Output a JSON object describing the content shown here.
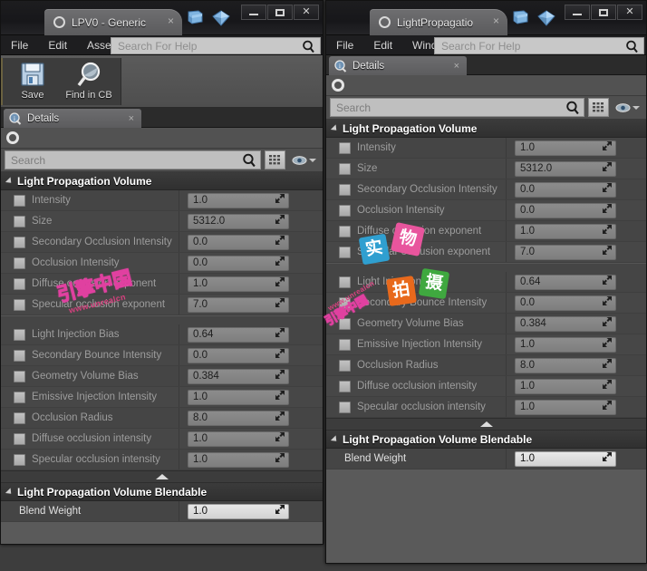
{
  "left_window": {
    "title_tab": "LPV0 - Generic",
    "tab_close": "×",
    "window_buttons": {
      "minimize": "minimize-icon",
      "maximize": "maximize-icon",
      "close": "✕"
    },
    "title_icons": [
      "book-icon",
      "gem-icon"
    ],
    "menu": [
      "File",
      "Edit",
      "Asset"
    ],
    "help_search_placeholder": "Search For Help",
    "toolbar": [
      {
        "icon": "save-icon",
        "label": "Save"
      },
      {
        "icon": "find-in-cb-icon",
        "label": "Find in CB"
      }
    ],
    "dock_tab": {
      "icon": "details-info-icon",
      "label": "Details",
      "close": "×"
    },
    "search_placeholder": "Search",
    "toolbar_right": {
      "grid_view": "grid-icon",
      "eye": "eye-icon",
      "caret": "chevron-down-icon"
    },
    "categories": [
      {
        "title": "Light Propagation Volume",
        "rows": [
          {
            "label": "Intensity",
            "value": "1.0",
            "checkbox": true
          },
          {
            "label": "Size",
            "value": "5312.0",
            "checkbox": true
          },
          {
            "label": "Secondary Occlusion Intensity",
            "value": "0.0",
            "checkbox": true
          },
          {
            "label": "Occlusion Intensity",
            "value": "0.0",
            "checkbox": true
          },
          {
            "label": "Diffuse occlusion exponent",
            "value": "1.0",
            "checkbox": true
          },
          {
            "label": "Specular occlusion exponent",
            "value": "7.0",
            "checkbox": true
          },
          {
            "label": "Light Injection Bias",
            "value": "0.64",
            "checkbox": true
          },
          {
            "label": "Secondary Bounce Intensity",
            "value": "0.0",
            "checkbox": true
          },
          {
            "label": "Geometry Volume Bias",
            "value": "0.384",
            "checkbox": true
          },
          {
            "label": "Emissive Injection Intensity",
            "value": "1.0",
            "checkbox": true
          },
          {
            "label": "Occlusion Radius",
            "value": "8.0",
            "checkbox": true
          },
          {
            "label": "Diffuse occlusion intensity",
            "value": "1.0",
            "checkbox": true
          },
          {
            "label": "Specular occlusion intensity",
            "value": "1.0",
            "checkbox": true
          }
        ]
      },
      {
        "title": "Light Propagation Volume Blendable",
        "rows": [
          {
            "label": "Blend Weight",
            "value": "1.0",
            "checkbox": false
          }
        ]
      }
    ]
  },
  "right_window": {
    "title_tab": "LightPropagatio",
    "tab_close": "×",
    "window_buttons": {
      "minimize": "minimize-icon",
      "maximize": "maximize-icon",
      "close": "✕"
    },
    "title_icons": [
      "book-icon",
      "gem-icon"
    ],
    "menu": [
      "File",
      "Edit",
      "Windo"
    ],
    "help_search_placeholder": "Search For Help",
    "dock_tab": {
      "icon": "details-info-icon",
      "label": "Details",
      "close": "×"
    },
    "search_placeholder": "Search",
    "toolbar_right": {
      "grid_view": "grid-icon",
      "eye": "eye-icon",
      "caret": "chevron-down-icon"
    },
    "categories": [
      {
        "title": "Light Propagation Volume",
        "rows": [
          {
            "label": "Intensity",
            "value": "1.0",
            "checkbox": true
          },
          {
            "label": "Size",
            "value": "5312.0",
            "checkbox": true
          },
          {
            "label": "Secondary Occlusion Intensity",
            "value": "0.0",
            "checkbox": true
          },
          {
            "label": "Occlusion Intensity",
            "value": "0.0",
            "checkbox": true
          },
          {
            "label": "Diffuse occlusion exponent",
            "value": "1.0",
            "checkbox": true
          },
          {
            "label": "Specular occlusion exponent",
            "value": "7.0",
            "checkbox": true
          },
          {
            "label": "Light Injection Bias",
            "value": "0.64",
            "checkbox": true
          },
          {
            "label": "Secondary Bounce Intensity",
            "value": "0.0",
            "checkbox": true
          },
          {
            "label": "Geometry Volume Bias",
            "value": "0.384",
            "checkbox": true
          },
          {
            "label": "Emissive Injection Intensity",
            "value": "1.0",
            "checkbox": true
          },
          {
            "label": "Occlusion Radius",
            "value": "8.0",
            "checkbox": true
          },
          {
            "label": "Diffuse occlusion intensity",
            "value": "1.0",
            "checkbox": true
          },
          {
            "label": "Specular occlusion intensity",
            "value": "1.0",
            "checkbox": true
          }
        ]
      },
      {
        "title": "Light Propagation Volume Blendable",
        "rows": [
          {
            "label": "Blend Weight",
            "value": "1.0",
            "checkbox": false
          }
        ]
      }
    ]
  },
  "watermarks": {
    "cn_left": "引擎中国",
    "url_left": "www.unrealcn",
    "boxes": [
      {
        "text": "实",
        "color": "#2f9fd0"
      },
      {
        "text": "物",
        "color": "#e8559d"
      },
      {
        "text": "拍",
        "color": "#e8691c"
      },
      {
        "text": "摄",
        "color": "#3fa83f"
      }
    ],
    "cn_right": "引擎中国",
    "url_right": "www.unrealcn"
  },
  "colors": {
    "panel_bg": "#454545",
    "window_bg": "#5a5a5a",
    "titlebar": "#1d1d1f",
    "accent_label": "#9d9d9d"
  }
}
